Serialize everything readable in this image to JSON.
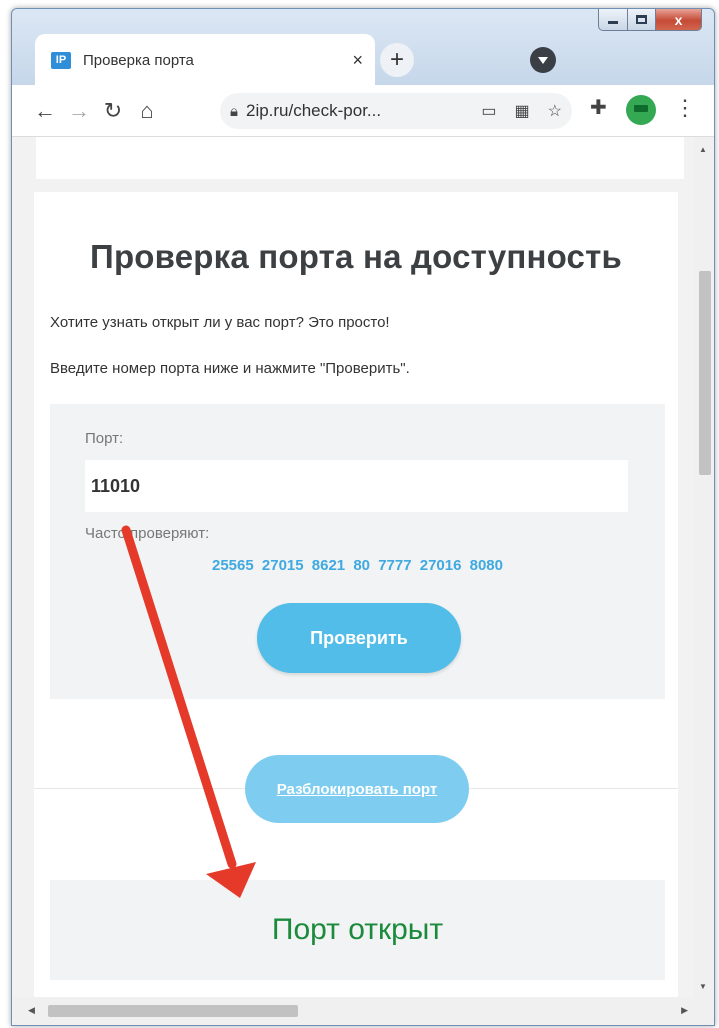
{
  "browser": {
    "tab_favicon": "IP",
    "tab_title": "Проверка порта",
    "tab_close": "×",
    "new_tab": "+",
    "url": "2ip.ru/check-por...",
    "window_close": "x"
  },
  "page": {
    "title": "Проверка порта на доступность",
    "intro_line1": "Хотите узнать открыт ли у вас порт? Это просто!",
    "intro_line2": "Введите номер порта ниже и нажмите \"Проверить\".",
    "port_label": "Порт:",
    "port_value": "11010",
    "frequent_label": "Часто проверяют:",
    "frequent_ports": [
      "25565",
      "27015",
      "8621",
      "80",
      "7777",
      "27016",
      "8080"
    ],
    "check_button": "Проверить",
    "unblock_button": "Разблокировать порт",
    "result": "Порт открыт"
  },
  "colors": {
    "accent_blue": "#52bde8",
    "link_blue": "#3fa9e0",
    "result_green": "#1b8a3a",
    "arrow_red": "#e53a2a"
  }
}
